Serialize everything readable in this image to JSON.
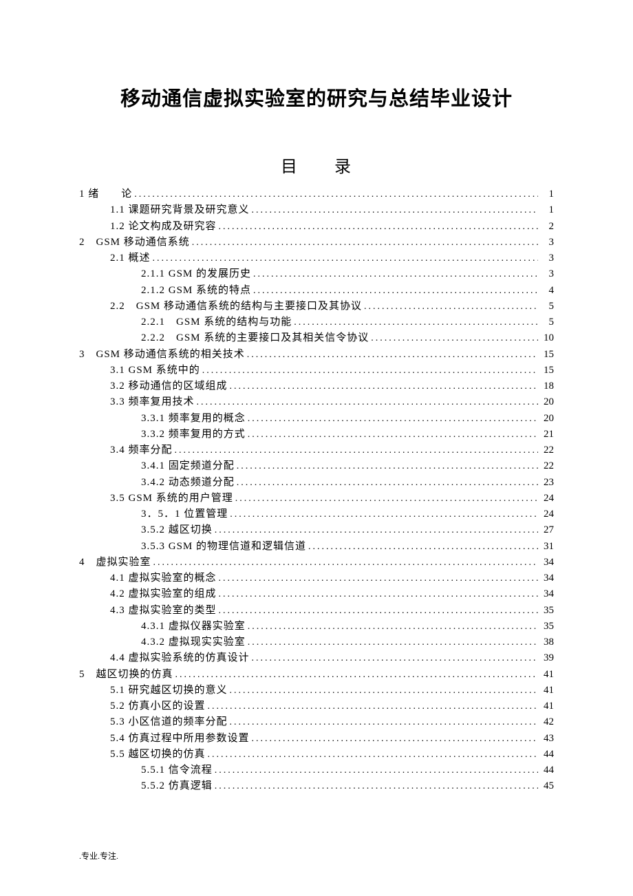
{
  "title": "移动通信虚拟实验室的研究与总结毕业设计",
  "toc_title": "目　　录",
  "footer": ".专业.专注.",
  "toc": [
    {
      "level": 0,
      "label": "1 绪　　论",
      "page": "1"
    },
    {
      "level": 1,
      "label": "1.1 课题研究背景及研究意义",
      "page": "1"
    },
    {
      "level": 1,
      "label": "1.2 论文构成及研究容",
      "page": "2"
    },
    {
      "level": 0,
      "label": "2　GSM 移动通信系统",
      "page": "3"
    },
    {
      "level": 1,
      "label": "2.1 概述",
      "page": "3"
    },
    {
      "level": 2,
      "label": "2.1.1 GSM 的发展历史",
      "page": "3"
    },
    {
      "level": 2,
      "label": "2.1.2 GSM 系统的特点",
      "page": "4"
    },
    {
      "level": 1,
      "label": "2.2　GSM 移动通信系统的结构与主要接口及其协议",
      "page": "5"
    },
    {
      "level": 2,
      "label": "2.2.1　GSM 系统的结构与功能",
      "page": "5"
    },
    {
      "level": 2,
      "label": "2.2.2　GSM 系统的主要接口及其相关信令协议",
      "page": "10"
    },
    {
      "level": 0,
      "label": "3　GSM 移动通信系统的相关技术",
      "page": "15"
    },
    {
      "level": 1,
      "label": "3.1 GSM 系统中的",
      "page": "15"
    },
    {
      "level": 1,
      "label": "3.2 移动通信的区域组成",
      "page": "18"
    },
    {
      "level": 1,
      "label": "3.3 频率复用技术",
      "page": "20"
    },
    {
      "level": 2,
      "label": "3.3.1 频率复用的概念",
      "page": "20"
    },
    {
      "level": 2,
      "label": "3.3.2 频率复用的方式",
      "page": "21"
    },
    {
      "level": 1,
      "label": "3.4 频率分配",
      "page": "22"
    },
    {
      "level": 2,
      "label": "3.4.1 固定频道分配",
      "page": "22"
    },
    {
      "level": 2,
      "label": "3.4.2 动态频道分配",
      "page": "23"
    },
    {
      "level": 1,
      "label": "3.5 GSM 系统的用户管理",
      "page": "24"
    },
    {
      "level": 2,
      "label": "3．5．1 位置管理",
      "page": "24"
    },
    {
      "level": 2,
      "label": "3.5.2 越区切换",
      "page": "27"
    },
    {
      "level": 2,
      "label": "3.5.3 GSM 的物理信道和逻辑信道",
      "page": "31"
    },
    {
      "level": 0,
      "label": "4　虚拟实验室",
      "page": "34"
    },
    {
      "level": 1,
      "label": "4.1 虚拟实验室的概念",
      "page": "34"
    },
    {
      "level": 1,
      "label": "4.2 虚拟实验室的组成",
      "page": "34"
    },
    {
      "level": 1,
      "label": "4.3 虚拟实验室的类型",
      "page": "35"
    },
    {
      "level": 2,
      "label": "4.3.1 虚拟仪器实验室",
      "page": "35"
    },
    {
      "level": 2,
      "label": "4.3.2 虚拟现实实验室",
      "page": "38"
    },
    {
      "level": 1,
      "label": "4.4 虚拟实验系统的仿真设计",
      "page": "39"
    },
    {
      "level": 0,
      "label": "5　越区切换的仿真",
      "page": "41"
    },
    {
      "level": 1,
      "label": "5.1 研究越区切换的意义",
      "page": "41"
    },
    {
      "level": 1,
      "label": "5.2 仿真小区的设置",
      "page": "41"
    },
    {
      "level": 1,
      "label": "5.3 小区信道的频率分配",
      "page": "42"
    },
    {
      "level": 1,
      "label": "5.4 仿真过程中所用参数设置",
      "page": "43"
    },
    {
      "level": 1,
      "label": "5.5 越区切换的仿真",
      "page": "44"
    },
    {
      "level": 2,
      "label": "5.5.1 信令流程",
      "page": "44"
    },
    {
      "level": 2,
      "label": "5.5.2 仿真逻辑",
      "page": "45"
    }
  ]
}
